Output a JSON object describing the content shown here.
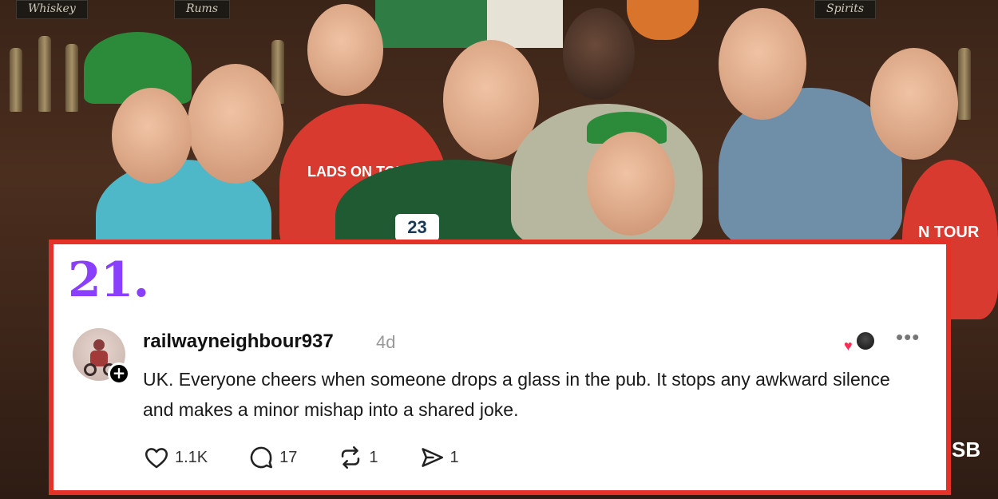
{
  "background": {
    "signs": [
      "Whiskey",
      "Rums",
      "Spirits"
    ],
    "shirt_texts": [
      "LADS ON TOUR",
      "23",
      "N TOUR",
      "SB"
    ]
  },
  "post": {
    "number": "21.",
    "username": "railwayneighbour937",
    "time_ago": "4d",
    "text": "UK. Everyone cheers when someone drops a glass in the pub. It stops any awkward silence and makes a minor mishap into a shared joke.",
    "icons": {
      "avatar": "profile-avatar",
      "follow": "plus-icon",
      "more": "more-options-icon"
    },
    "actions": {
      "likes": "1.1K",
      "replies": "17",
      "reposts": "1",
      "shares": "1"
    }
  },
  "colors": {
    "frame": "#e53228",
    "number": "#8a3ffc",
    "heart": "#ff2d55"
  }
}
